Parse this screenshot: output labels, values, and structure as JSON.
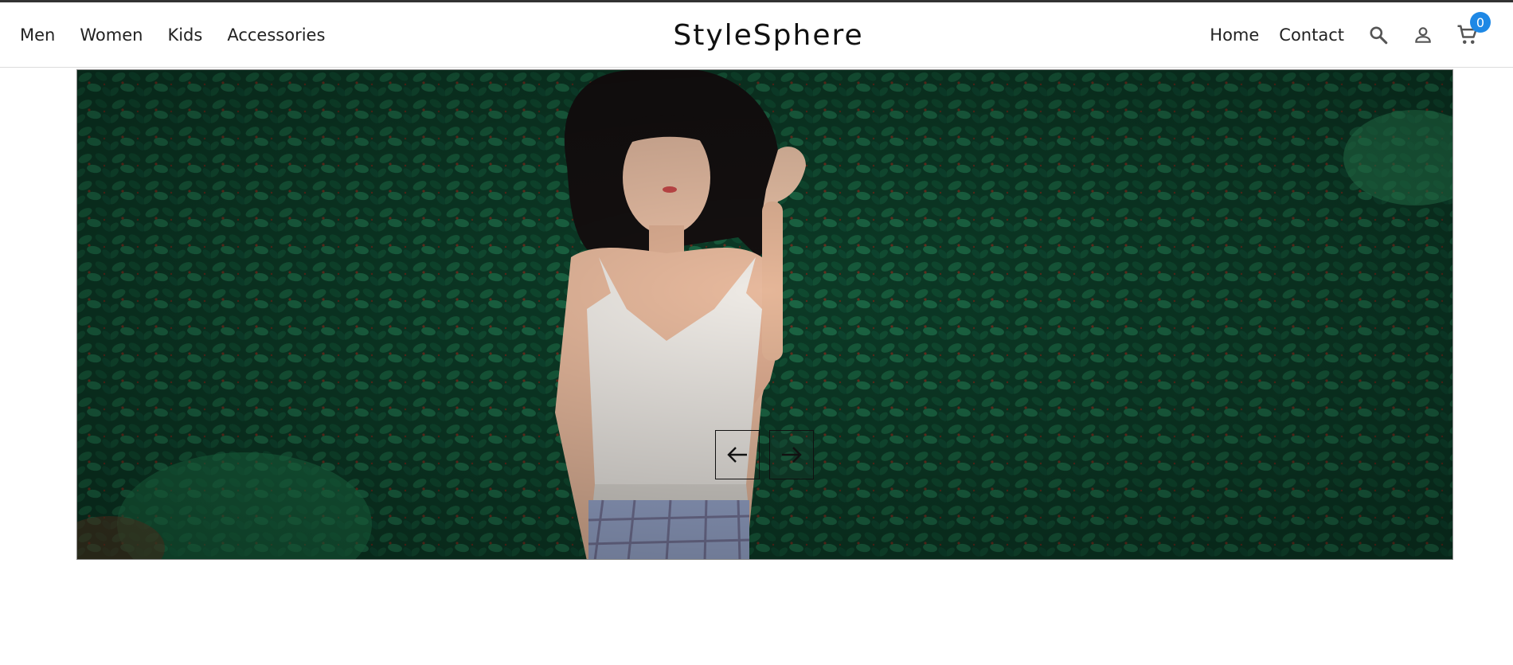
{
  "nav": {
    "left_links": [
      "Men",
      "Women",
      "Kids",
      "Accessories"
    ],
    "brand": "StyleSphere",
    "right_links": [
      "Home",
      "Contact"
    ],
    "cart_count": "0"
  },
  "icons": {
    "search": "search-icon",
    "account": "account-icon",
    "cart": "cart-icon",
    "prev": "arrow-left-icon",
    "next": "arrow-right-icon"
  },
  "colors": {
    "badge": "#1e88e5",
    "foliage": "#0b3b27"
  },
  "hero": {
    "slide_alt": "Woman in white camisole standing in front of green ivy wall"
  }
}
